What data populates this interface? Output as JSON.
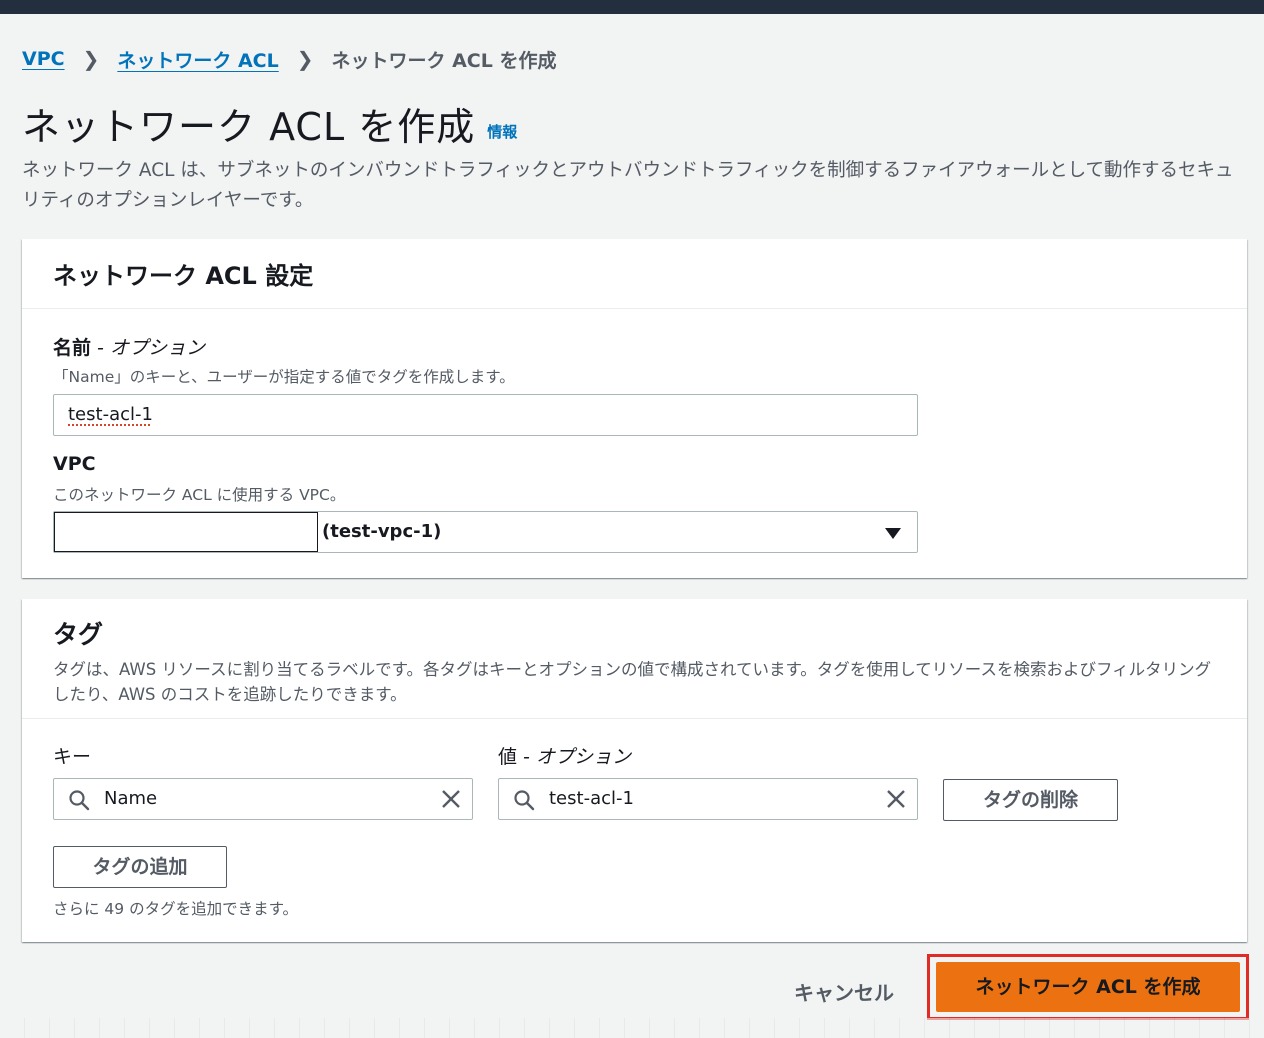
{
  "breadcrumb": {
    "items": [
      "VPC",
      "ネットワーク ACL"
    ],
    "current": "ネットワーク ACL を作成"
  },
  "page": {
    "title": "ネットワーク ACL を作成",
    "info_link": "情報",
    "description": "ネットワーク ACL は、サブネットのインバウンドトラフィックとアウトバウンドトラフィックを制御するファイアウォールとして動作するセキュリティのオプションレイヤーです。"
  },
  "settings": {
    "title": "ネットワーク ACL 設定",
    "name_label": "名前",
    "name_label_optional": " - オプション",
    "name_description": "「Name」のキーと、ユーザーが指定する値でタグを作成します。",
    "name_value": "test-acl-1",
    "vpc_label": "VPC",
    "vpc_description": "このネットワーク ACL に使用する VPC。",
    "vpc_value": "(test-vpc-1)"
  },
  "tags": {
    "title": "タグ",
    "description": "タグは、AWS リソースに割り当てるラベルです。各タグはキーとオプションの値で構成されています。タグを使用してリソースを検索およびフィルタリングしたり、AWS のコストを追跡したりできます。",
    "key_label": "キー",
    "value_label": "値",
    "value_label_optional": " - オプション",
    "rows": [
      {
        "key": "Name",
        "value": "test-acl-1"
      }
    ],
    "remove_button": "タグの削除",
    "add_button": "タグの追加",
    "remaining_note": "さらに 49 のタグを追加できます。"
  },
  "footer": {
    "cancel_label": "キャンセル",
    "create_label": "ネットワーク ACL を作成"
  },
  "colors": {
    "link": "#0073bb",
    "primary": "#ec7211",
    "highlight_border": "#df2c24",
    "header_bar": "#232f3e"
  }
}
